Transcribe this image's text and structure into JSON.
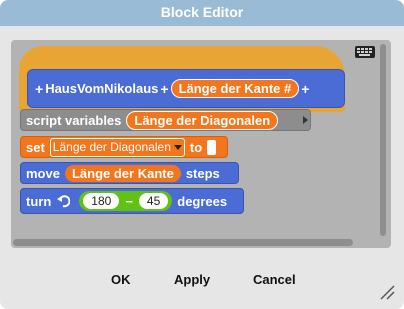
{
  "dialog": {
    "title": "Block Editor",
    "buttons": {
      "ok": "OK",
      "apply": "Apply",
      "cancel": "Cancel"
    }
  },
  "prototype": {
    "name": "HausVomNikolaus",
    "plus": "+",
    "parameter": "Länge der Kante #"
  },
  "blocks": {
    "script_variables": {
      "label": "script variables",
      "var": "Länge der Diagonalen"
    },
    "set": {
      "label": "set",
      "var": "Länge der Diagonalen",
      "to": "to"
    },
    "move": {
      "label": "move",
      "var": "Länge der Kante",
      "suffix": "steps"
    },
    "turn": {
      "label": "turn",
      "a": "180",
      "op": "−",
      "b": "45",
      "suffix": "degrees"
    }
  },
  "icons": {
    "keyboard": "keyboard-icon",
    "turn": "turn-left-icon",
    "resize": "resize-handle-icon"
  },
  "colors": {
    "title_bar": "#99bbd6",
    "hat": "#e8a534",
    "motion": "#4a6cd4",
    "variables": "#f3761d",
    "operators": "#62c213",
    "other": "#8d8d8d"
  }
}
